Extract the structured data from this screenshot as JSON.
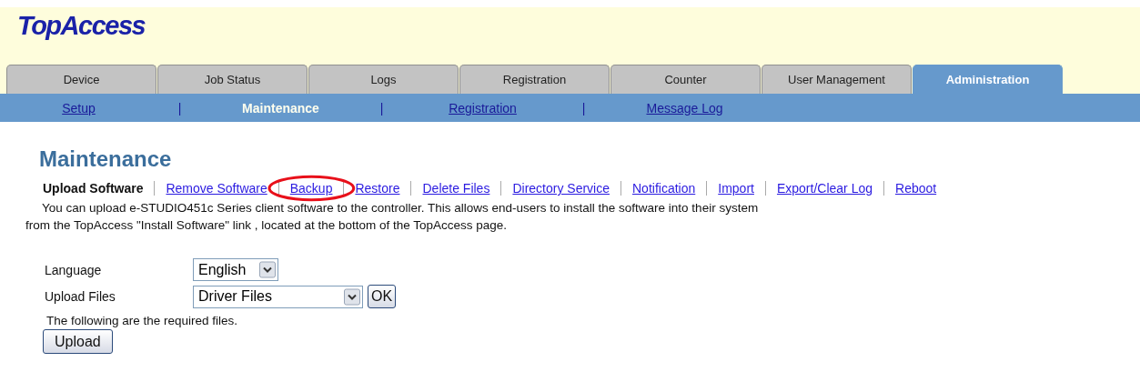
{
  "logo": "TopAccess",
  "tabs": [
    {
      "label": "Device",
      "selected": false
    },
    {
      "label": "Job Status",
      "selected": false
    },
    {
      "label": "Logs",
      "selected": false
    },
    {
      "label": "Registration",
      "selected": false
    },
    {
      "label": "Counter",
      "selected": false
    },
    {
      "label": "User Management",
      "selected": false
    },
    {
      "label": "Administration",
      "selected": true
    }
  ],
  "subnav": [
    {
      "label": "Setup",
      "selected": false
    },
    {
      "label": "Maintenance",
      "selected": true
    },
    {
      "label": "Registration",
      "selected": false
    },
    {
      "label": "Message Log",
      "selected": false
    }
  ],
  "subnav_separator": "|",
  "page_title": "Maintenance",
  "section_links": [
    {
      "label": "Upload Software",
      "selected": true,
      "highlighted": false
    },
    {
      "label": "Remove Software",
      "selected": false,
      "highlighted": false
    },
    {
      "label": "Backup",
      "selected": false,
      "highlighted": true
    },
    {
      "label": "Restore",
      "selected": false,
      "highlighted": false
    },
    {
      "label": "Delete Files",
      "selected": false,
      "highlighted": false
    },
    {
      "label": "Directory Service",
      "selected": false,
      "highlighted": false
    },
    {
      "label": "Notification",
      "selected": false,
      "highlighted": false
    },
    {
      "label": "Import",
      "selected": false,
      "highlighted": false
    },
    {
      "label": "Export/Clear Log",
      "selected": false,
      "highlighted": false
    },
    {
      "label": "Reboot",
      "selected": false,
      "highlighted": false
    }
  ],
  "description": "You can upload e-STUDIO451c Series client software to the controller. This allows end-users to install the software into their system from the TopAccess \"Install Software\" link , located at the bottom of the TopAccess page.",
  "form": [
    {
      "label": "Language",
      "value": "English"
    },
    {
      "label": "Upload Files",
      "value": "Driver Files",
      "button": "OK"
    }
  ],
  "note": "The following are the required files.",
  "upload_button": "Upload"
}
